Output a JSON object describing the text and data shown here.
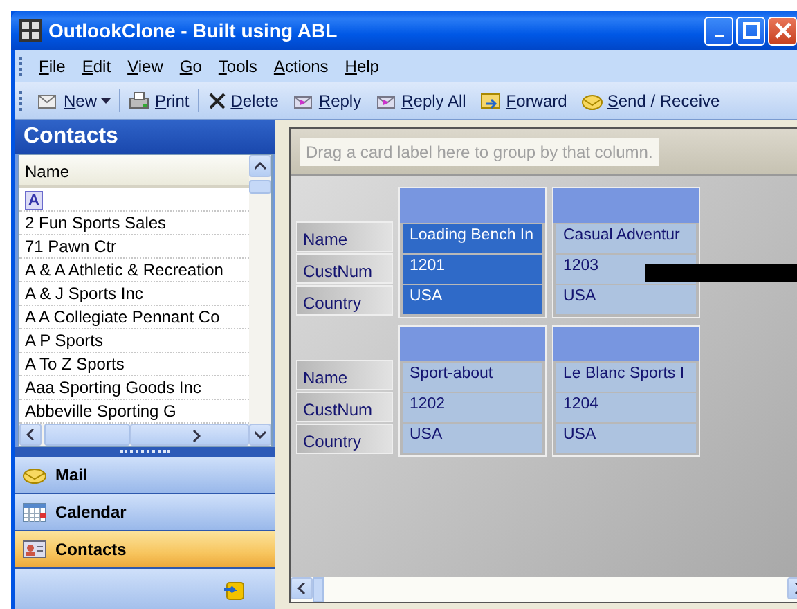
{
  "window": {
    "title": "OutlookClone - Built using ABL"
  },
  "menu": [
    "File",
    "Edit",
    "View",
    "Go",
    "Tools",
    "Actions",
    "Help"
  ],
  "toolbar": [
    {
      "label": "New",
      "kind": "dropdown"
    },
    {
      "label": "Print",
      "kind": "print"
    },
    {
      "label": "Delete",
      "kind": "delete"
    },
    {
      "label": "Reply",
      "kind": "reply"
    },
    {
      "label": "Reply All",
      "kind": "replyall"
    },
    {
      "label": "Forward",
      "kind": "forward"
    },
    {
      "label": "Send / Receive",
      "kind": "send"
    }
  ],
  "sidebar": {
    "title": "Contacts",
    "list": {
      "column": "Name",
      "index_letter": "A",
      "items": [
        "2 Fun Sports Sales",
        "71 Pawn Ctr",
        "A & A Athletic & Recreation",
        "A & J Sports Inc",
        "A A Collegiate Pennant Co",
        "A P Sports",
        "A To Z Sports",
        "Aaa Sporting Goods Inc",
        "Abbeville Sporting G"
      ]
    },
    "nav": [
      {
        "label": "Mail",
        "kind": "mail",
        "selected": false
      },
      {
        "label": "Calendar",
        "kind": "calendar",
        "selected": false
      },
      {
        "label": "Contacts",
        "kind": "contacts",
        "selected": true
      }
    ]
  },
  "cards": {
    "group_hint": "Drag a card label here to group by that column.",
    "rows": [
      {
        "labels": [
          "Name",
          "CustNum",
          "Country"
        ],
        "cards": [
          {
            "values": [
              "Loading Bench In",
              "1201",
              "USA"
            ],
            "selected": true
          },
          {
            "values": [
              "Casual Adventur",
              "1203",
              "USA"
            ],
            "selected": false
          }
        ]
      },
      {
        "labels": [
          "Name",
          "CustNum",
          "Country"
        ],
        "cards": [
          {
            "values": [
              "Sport-about",
              "1202",
              "USA"
            ],
            "selected": false
          },
          {
            "values": [
              "Le Blanc Sports I",
              "1204",
              "USA"
            ],
            "selected": false
          }
        ]
      }
    ]
  }
}
